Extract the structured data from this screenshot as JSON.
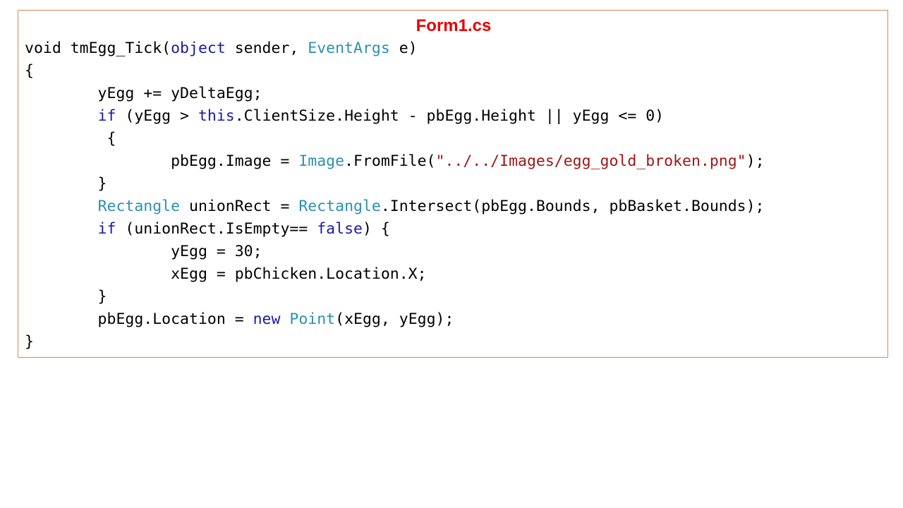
{
  "document": {
    "title": "Form1.cs",
    "colors": {
      "title": "#e60000",
      "border": "#d08a5a",
      "keyword": "#1a1aa6",
      "type": "#2b91af",
      "string": "#a31515",
      "plain": "#000000"
    },
    "code_lines": [
      [
        {
          "t": "plain",
          "v": "void tmEgg_Tick("
        },
        {
          "t": "keyword",
          "v": "object"
        },
        {
          "t": "plain",
          "v": " sender, "
        },
        {
          "t": "type",
          "v": "EventArgs"
        },
        {
          "t": "plain",
          "v": " e)"
        }
      ],
      [
        {
          "t": "plain",
          "v": "{"
        }
      ],
      [
        {
          "t": "plain",
          "v": "        yEgg += yDeltaEgg;"
        }
      ],
      [
        {
          "t": "plain",
          "v": "        "
        },
        {
          "t": "keyword",
          "v": "if"
        },
        {
          "t": "plain",
          "v": " (yEgg > "
        },
        {
          "t": "keyword",
          "v": "this"
        },
        {
          "t": "plain",
          "v": ".ClientSize.Height - pbEgg.Height || yEgg <= 0)"
        }
      ],
      [
        {
          "t": "plain",
          "v": "         {"
        }
      ],
      [
        {
          "t": "plain",
          "v": "                pbEgg.Image = "
        },
        {
          "t": "type",
          "v": "Image"
        },
        {
          "t": "plain",
          "v": ".FromFile("
        },
        {
          "t": "string",
          "v": "\"../../Images/egg_gold_broken.png\""
        },
        {
          "t": "plain",
          "v": ");"
        }
      ],
      [
        {
          "t": "plain",
          "v": "        }"
        }
      ],
      [
        {
          "t": "plain",
          "v": "        "
        },
        {
          "t": "type",
          "v": "Rectangle"
        },
        {
          "t": "plain",
          "v": " unionRect = "
        },
        {
          "t": "type",
          "v": "Rectangle"
        },
        {
          "t": "plain",
          "v": ".Intersect(pbEgg.Bounds, pbBasket.Bounds);"
        }
      ],
      [
        {
          "t": "plain",
          "v": "        "
        },
        {
          "t": "keyword",
          "v": "if"
        },
        {
          "t": "plain",
          "v": " (unionRect.IsEmpty== "
        },
        {
          "t": "keyword",
          "v": "false"
        },
        {
          "t": "plain",
          "v": ") {"
        }
      ],
      [
        {
          "t": "plain",
          "v": "                yEgg = 30;"
        }
      ],
      [
        {
          "t": "plain",
          "v": "                xEgg = pbChicken.Location.X;"
        }
      ],
      [
        {
          "t": "plain",
          "v": "        }"
        }
      ],
      [
        {
          "t": "plain",
          "v": "        pbEgg.Location = "
        },
        {
          "t": "keyword",
          "v": "new"
        },
        {
          "t": "plain",
          "v": " "
        },
        {
          "t": "type",
          "v": "Point"
        },
        {
          "t": "plain",
          "v": "(xEgg, yEgg);"
        }
      ],
      [
        {
          "t": "plain",
          "v": "}"
        }
      ]
    ]
  }
}
